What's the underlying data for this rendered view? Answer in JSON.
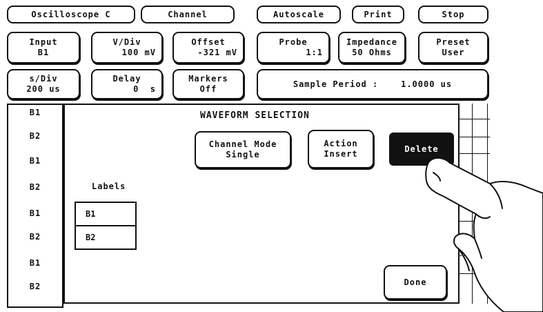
{
  "top_row": {
    "oscilloscope": "Oscilloscope C",
    "channel": "Channel",
    "autoscale": "Autoscale",
    "print": "Print",
    "stop": "Stop"
  },
  "second_row": {
    "input": {
      "label": "Input",
      "value": "B1"
    },
    "v_div": {
      "label": "V/Div",
      "value": "100 mV"
    },
    "offset": {
      "label": "Offset",
      "value": "-321 mV"
    },
    "probe": {
      "label": "Probe",
      "value": "1:1"
    },
    "impedance": {
      "label": "Impedance",
      "value": "50 Ohms"
    },
    "preset": {
      "label": "Preset",
      "value": "User"
    }
  },
  "third_row": {
    "s_div": {
      "label": "s/Div",
      "value": "200 us"
    },
    "delay": {
      "label": "Delay",
      "value": "0  s"
    },
    "markers": {
      "label": "Markers",
      "value": "Off"
    },
    "sample_period": "Sample Period :    1.0000 us"
  },
  "sidebar": {
    "items": [
      "B1",
      "B2",
      "B1",
      "B2",
      "B1",
      "B2",
      "B1",
      "B2"
    ]
  },
  "waveform_selection": {
    "title": "WAVEFORM SELECTION",
    "channel_mode": {
      "label": "Channel Mode",
      "value": "Single"
    },
    "action": {
      "label": "Action",
      "value": "Insert"
    },
    "delete": "Delete",
    "labels_heading": "Labels",
    "labels": [
      "B1",
      "B2"
    ],
    "done": "Done"
  }
}
